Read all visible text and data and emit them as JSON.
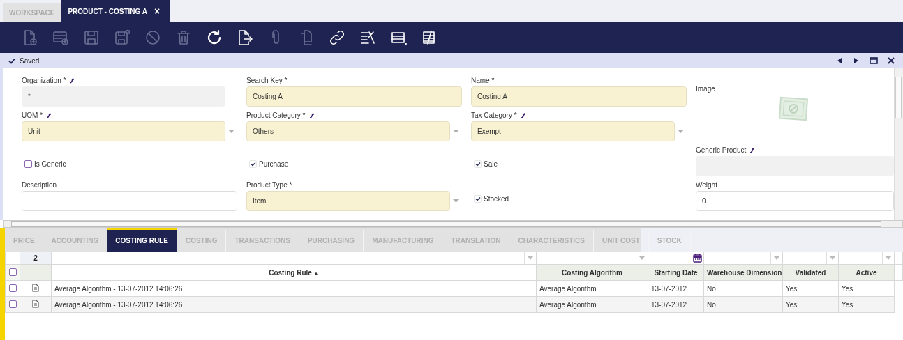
{
  "window_tabs": [
    {
      "label": "WORKSPACE",
      "selected": false
    },
    {
      "label": "PRODUCT - COSTING A",
      "selected": true,
      "close_glyph": "×"
    }
  ],
  "toolbar": [
    {
      "kind": "new-document",
      "disabled": true
    },
    {
      "kind": "new-row",
      "disabled": true
    },
    {
      "kind": "save",
      "disabled": true
    },
    {
      "kind": "save-close",
      "disabled": true
    },
    {
      "kind": "cancel",
      "disabled": true
    },
    {
      "kind": "delete",
      "disabled": true
    },
    {
      "kind": "refresh",
      "disabled": false
    },
    {
      "kind": "export",
      "disabled": false
    },
    {
      "kind": "attach",
      "disabled": true
    },
    {
      "kind": "clone",
      "disabled": true
    },
    {
      "kind": "link",
      "disabled": false
    },
    {
      "kind": "tools",
      "disabled": false
    },
    {
      "kind": "grid-view",
      "disabled": false
    },
    {
      "kind": "notes",
      "disabled": false
    }
  ],
  "status_bar": {
    "message": "Saved"
  },
  "fields": [
    {
      "kind": "readonly",
      "label": "Organization *",
      "link": true,
      "value": "*"
    },
    {
      "kind": "text",
      "label": "Search Key *",
      "link": false,
      "value": "Costing A"
    },
    {
      "kind": "text",
      "label": "Name *",
      "link": false,
      "value": "Costing A"
    },
    {
      "kind": "image",
      "label": "Image"
    },
    {
      "kind": "select",
      "label": "UOM *",
      "link": true,
      "value": "Unit"
    },
    {
      "kind": "select",
      "label": "Product Category *",
      "link": true,
      "value": "Others"
    },
    {
      "kind": "select",
      "label": "Tax Category *",
      "link": true,
      "value": "Exempt"
    },
    {
      "kind": "checkbox",
      "label": "Is Generic",
      "checked": false
    },
    {
      "kind": "checkbox",
      "label": "Purchase",
      "checked": true
    },
    {
      "kind": "checkbox",
      "label": "Sale",
      "checked": true
    },
    {
      "kind": "readonly",
      "label": "Generic Product",
      "link": true
    },
    {
      "kind": "text",
      "label": "Description",
      "link": false
    },
    {
      "kind": "select",
      "label": "Product Type *",
      "link": false,
      "value": "Item"
    },
    {
      "kind": "checkbox",
      "label": "Stocked",
      "checked": true
    },
    {
      "kind": "text",
      "label": "Weight",
      "link": false,
      "value": "0"
    }
  ],
  "subtabs": [
    {
      "label": "PRICE",
      "selected": false
    },
    {
      "label": "ACCOUNTING",
      "selected": false
    },
    {
      "label": "COSTING RULE",
      "selected": true
    },
    {
      "label": "COSTING",
      "selected": false
    },
    {
      "label": "TRANSACTIONS",
      "selected": false
    },
    {
      "label": "PURCHASING",
      "selected": false
    },
    {
      "label": "MANUFACTURING",
      "selected": false
    },
    {
      "label": "TRANSLATION",
      "selected": false
    },
    {
      "label": "CHARACTERISTICS",
      "selected": false
    },
    {
      "label": "UNIT COST",
      "selected": false
    },
    {
      "label": "STOCK",
      "selected": false
    }
  ],
  "grid": {
    "record_count": "2",
    "all_selected": false,
    "columns": [
      {
        "label": "Costing Rule",
        "sort_indicator": "▲",
        "kind": "select"
      },
      {
        "label": "Costing Algorithm",
        "kind": "select"
      },
      {
        "label": "Starting Date",
        "kind": "date"
      },
      {
        "label": "Warehouse Dimension",
        "kind": "select"
      },
      {
        "label": "Validated",
        "kind": "select"
      },
      {
        "label": "Active",
        "kind": "select"
      }
    ],
    "rows": [
      {
        "selected": false,
        "cells": [
          "Average Algorithm - 13-07-2012 14:06:26",
          "Average Algorithm",
          "13-07-2012",
          "No",
          "Yes",
          "Yes"
        ]
      },
      {
        "selected": false,
        "cells": [
          "Average Algorithm - 13-07-2012 14:06:26",
          "Average Algorithm",
          "13-07-2012",
          "No",
          "Yes",
          "Yes"
        ]
      }
    ]
  }
}
